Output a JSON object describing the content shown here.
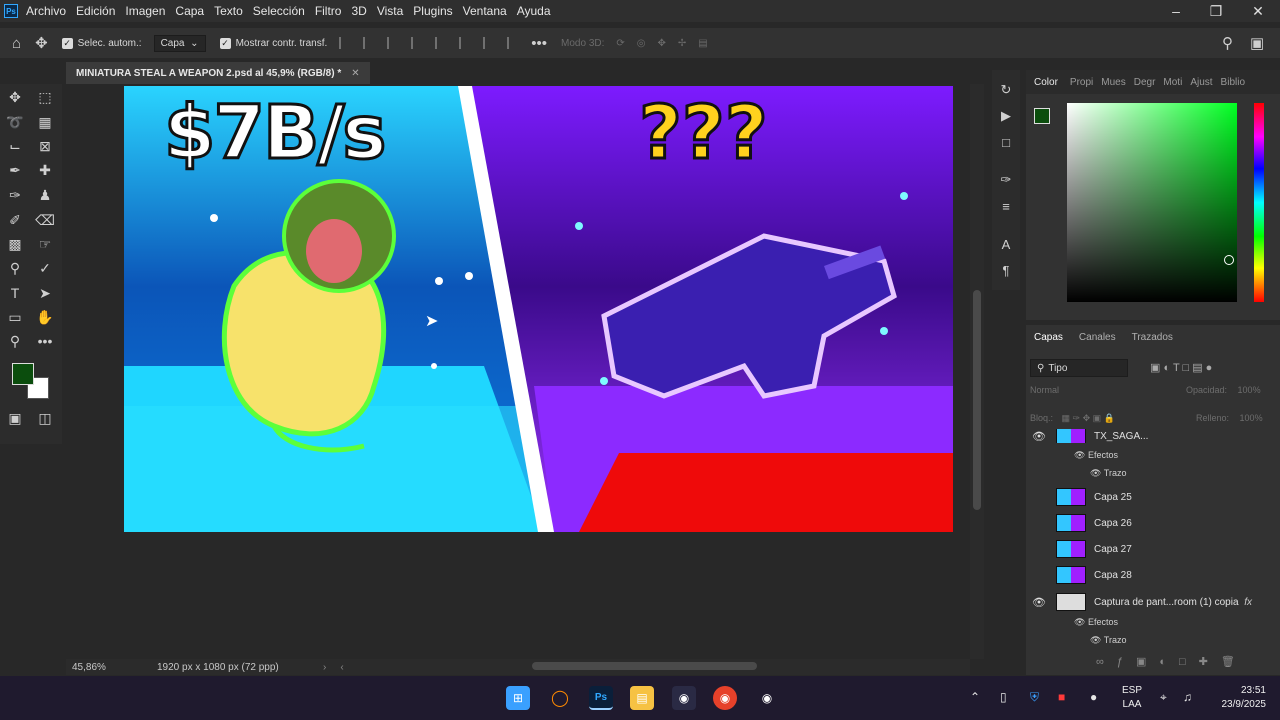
{
  "app": {
    "logo_text": "Ps"
  },
  "menu": [
    "Archivo",
    "Edición",
    "Imagen",
    "Capa",
    "Texto",
    "Selección",
    "Filtro",
    "3D",
    "Vista",
    "Plugins",
    "Ventana",
    "Ayuda"
  ],
  "options": {
    "auto_select_label": "Selec. autom.:",
    "auto_select_value": "Capa",
    "show_transform_label": "Mostrar contr. transf.",
    "mode_3d_label": "Modo 3D:"
  },
  "document": {
    "tab_title": "MINIATURA STEAL A WEAPON 2.psd al 45,9% (RGB/8) *"
  },
  "artwork": {
    "left_text": "$7B/s",
    "right_text": "???"
  },
  "status": {
    "zoom": "45,86%",
    "doc_info": "1920 px x 1080 px (72 ppp)"
  },
  "color_panel": {
    "tabs": [
      "Color",
      "Propi",
      "Mues",
      "Degr",
      "Moti",
      "Ajust",
      "Biblio"
    ],
    "fg_color": "#0b4d0d",
    "bg_color": "#ffffff"
  },
  "layers_panel": {
    "tabs": [
      "Capas",
      "Canales",
      "Trazados"
    ],
    "filter": "Tipo",
    "blend_mode": "Normal",
    "opacity_label": "Opacidad:",
    "opacity_value": "100%",
    "lock_label": "Bloq.:",
    "fill_label": "Relleno:",
    "fill_value": "100%",
    "top_partial_layer": "TX_SAGA...",
    "effects_label": "Efectos",
    "stroke_label": "Trazo",
    "layers": [
      "Capa 25",
      "Capa 26",
      "Capa 27",
      "Capa 28"
    ],
    "bottom_layer": "Captura de pant...room (1) copia",
    "fx_label": "fx"
  },
  "taskbar": {
    "lang_top": "ESP",
    "lang_bottom": "LAA",
    "time": "23:51",
    "date": "23/9/2025"
  }
}
